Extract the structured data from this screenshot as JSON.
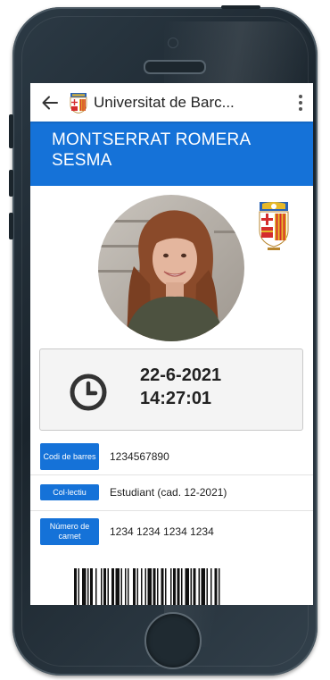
{
  "app_bar": {
    "back_icon": "arrow-left-icon",
    "logo_icon": "university-shield-icon",
    "title": "Universitat de Barc...",
    "menu_icon": "more-vert-icon"
  },
  "card": {
    "holder_name": "MONTSERRAT ROMERA SESMA",
    "photo_icon": "student-photo",
    "emblem_icon": "university-crest-icon",
    "timestamp": {
      "date": "22-6-2021",
      "time": "14:27:01",
      "icon": "clock-icon"
    },
    "fields": [
      {
        "label": "Codi de barres",
        "value": "1234567890"
      },
      {
        "label": "Col·lectiu",
        "value": "Estudiant (cad. 12-2021)"
      },
      {
        "label": "Número de carnet",
        "value": "1234 1234 1234 1234"
      }
    ],
    "barcode_icon": "barcode-icon"
  },
  "colors": {
    "accent": "#1572d8",
    "phone_body": "#1f2a31",
    "crest_red": "#d42d2d",
    "crest_gold": "#e7b928"
  }
}
